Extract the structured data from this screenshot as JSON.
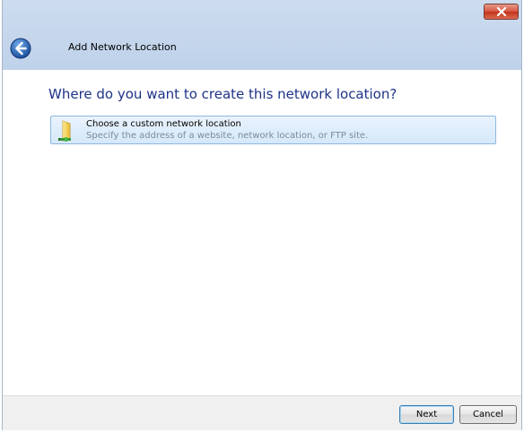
{
  "wizard": {
    "title": "Add Network Location",
    "heading": "Where do you want to create this network location?"
  },
  "options": [
    {
      "title": "Choose a custom network location",
      "description": "Specify the address of a website, network location, or FTP site.",
      "icon": "network-folder-icon"
    }
  ],
  "buttons": {
    "next": "Next",
    "cancel": "Cancel"
  },
  "colors": {
    "heading": "#1e3287",
    "titlebar": "#c6d8ee",
    "option_bg": "#dcecfc",
    "close": "#c8432f"
  }
}
